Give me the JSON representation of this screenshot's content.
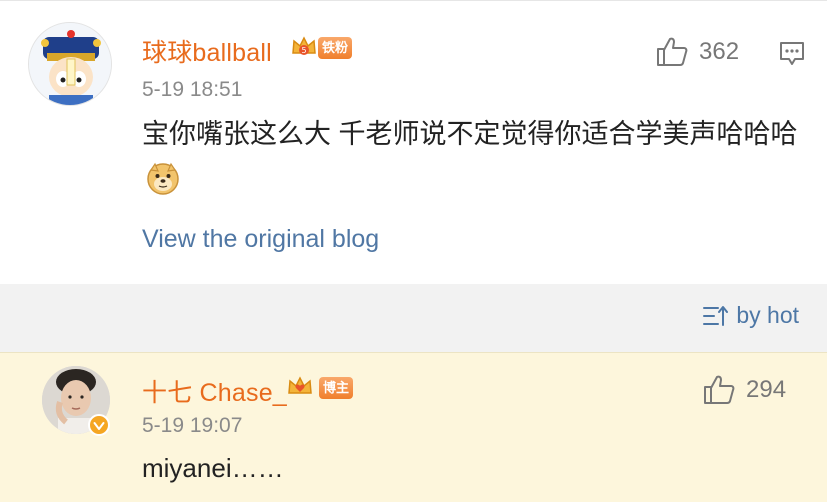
{
  "comments": [
    {
      "username": "球球ballball",
      "badge": "铁粉",
      "timestamp": "5-19 18:51",
      "likes": "362",
      "text": "宝你嘴张这么大 千老师说不定觉得你适合学美声哈哈哈",
      "emoji": "doge-emoji",
      "link": "View the original blog"
    },
    {
      "username": "十七 Chase_",
      "badge": "博主",
      "verified": true,
      "timestamp": "5-19 19:07",
      "likes": "294",
      "text": "miyanei……"
    }
  ],
  "sort": {
    "label": "by hot"
  },
  "colors": {
    "username": "#e86b1d",
    "link": "#5077a4",
    "highlight_bg": "#fdf6dc",
    "badge_orange": "#f07f2c",
    "verified_gold": "#f5a623"
  }
}
